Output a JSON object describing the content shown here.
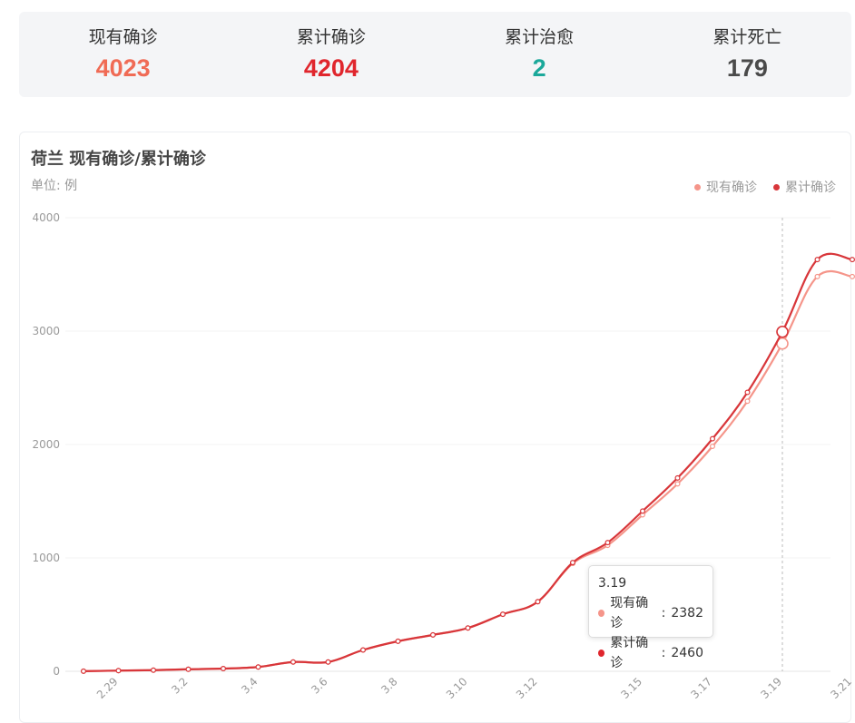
{
  "stats": [
    {
      "label": "现有确诊",
      "value": "4023",
      "color": "#f06b55"
    },
    {
      "label": "累计确诊",
      "value": "4204",
      "color": "#e0262d"
    },
    {
      "label": "累计治愈",
      "value": "2",
      "color": "#1aa89a"
    },
    {
      "label": "累计死亡",
      "value": "179",
      "color": "#4a4a4a"
    }
  ],
  "chart_data": {
    "type": "line",
    "title": "荷兰 现有确诊/累计确诊",
    "unit": "单位: 例",
    "x": [
      "2.28",
      "2.29",
      "3.1",
      "3.2",
      "3.3",
      "3.4",
      "3.5",
      "3.6",
      "3.7",
      "3.8",
      "3.9",
      "3.10",
      "3.11",
      "3.12",
      "3.13",
      "3.14",
      "3.15",
      "3.16",
      "3.17",
      "3.18",
      "3.19",
      "3.20",
      "3.21"
    ],
    "tick_labels": [
      "2.29",
      "3.2",
      "3.4",
      "3.6",
      "3.8",
      "3.10",
      "3.12",
      "3.15",
      "3.17",
      "3.19",
      "3.21"
    ],
    "ylim": [
      0,
      4000
    ],
    "yticks": [
      0,
      1000,
      2000,
      3000,
      4000
    ],
    "grid": true,
    "legend_position": "top-right",
    "series": [
      {
        "name": "现有确诊",
        "color": "#f5958a",
        "values": [
          1,
          6,
          10,
          18,
          24,
          38,
          82,
          82,
          188,
          265,
          321,
          382,
          503,
          614,
          951,
          1111,
          1380,
          1653,
          1984,
          2382,
          2890,
          3481,
          3481
        ]
      },
      {
        "name": "累计确诊",
        "color": "#d8363a",
        "values": [
          1,
          6,
          10,
          18,
          24,
          38,
          82,
          82,
          188,
          265,
          321,
          382,
          503,
          614,
          959,
          1135,
          1413,
          1705,
          2051,
          2460,
          2994,
          3631,
          3631
        ]
      }
    ],
    "tooltip": {
      "x": "3.19",
      "rows": [
        {
          "name": "现有确诊",
          "value": "2382",
          "color": "#f5958a"
        },
        {
          "name": "累计确诊",
          "value": "2460",
          "color": "#e0262d"
        }
      ]
    }
  }
}
